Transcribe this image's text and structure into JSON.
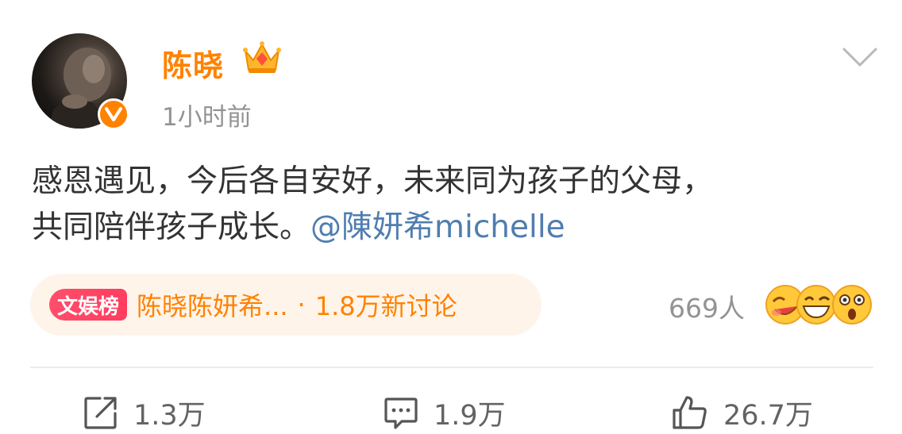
{
  "post": {
    "author": {
      "name": "陈晓",
      "time": "1小时前"
    },
    "text_line1": "感恩遇见，今后各自安好，未来同为孩子的父母，",
    "text_line2": "共同陪伴孩子成长。",
    "mention": "@陳妍希michelle"
  },
  "topic": {
    "badge": "文娱榜",
    "title": "陈晓陈妍希...",
    "separator": "·",
    "count": "1.8万新讨论"
  },
  "reactions": {
    "count": "669人"
  },
  "actions": {
    "share": "1.3万",
    "comment": "1.9万",
    "like": "26.7万"
  },
  "colors": {
    "brand_orange": "#ff8200",
    "mention_blue": "#507daf",
    "badge_red": "#ff4e6b",
    "text": "#333333",
    "muted": "#939393"
  },
  "icons": [
    "avatar",
    "verified-v-icon",
    "crown-icon",
    "chevron-down-icon",
    "reaction-emoji-icons",
    "share-icon",
    "comment-icon",
    "like-icon"
  ]
}
